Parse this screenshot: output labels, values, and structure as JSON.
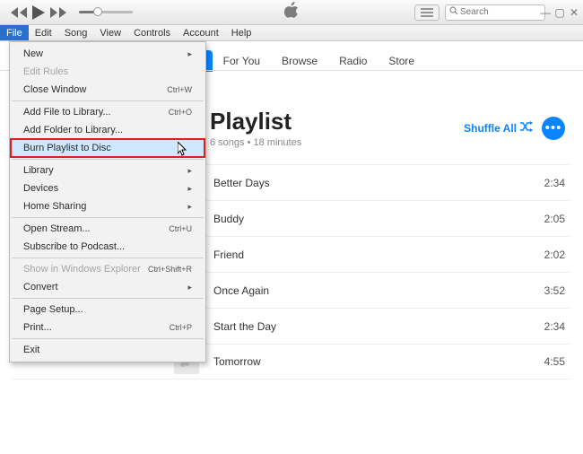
{
  "search": {
    "placeholder": "Search"
  },
  "menubar": [
    "File",
    "Edit",
    "Song",
    "View",
    "Controls",
    "Account",
    "Help"
  ],
  "file_menu": [
    {
      "label": "New",
      "shortcut": "",
      "sub": true
    },
    {
      "label": "Edit Rules",
      "shortcut": "",
      "disabled": true
    },
    {
      "label": "Close Window",
      "shortcut": "Ctrl+W"
    },
    {
      "sep": true
    },
    {
      "label": "Add File to Library...",
      "shortcut": "Ctrl+O"
    },
    {
      "label": "Add Folder to Library...",
      "shortcut": ""
    },
    {
      "label": "Burn Playlist to Disc",
      "shortcut": "",
      "highlight": true
    },
    {
      "sep": true
    },
    {
      "label": "Library",
      "shortcut": "",
      "sub": true
    },
    {
      "label": "Devices",
      "shortcut": "",
      "sub": true
    },
    {
      "label": "Home Sharing",
      "shortcut": "",
      "sub": true
    },
    {
      "sep": true
    },
    {
      "label": "Open Stream...",
      "shortcut": "Ctrl+U"
    },
    {
      "label": "Subscribe to Podcast...",
      "shortcut": ""
    },
    {
      "sep": true
    },
    {
      "label": "Show in Windows Explorer",
      "shortcut": "Ctrl+Shift+R",
      "disabled": true
    },
    {
      "label": "Convert",
      "shortcut": "",
      "sub": true
    },
    {
      "sep": true
    },
    {
      "label": "Page Setup...",
      "shortcut": ""
    },
    {
      "label": "Print...",
      "shortcut": "Ctrl+P"
    },
    {
      "sep": true
    },
    {
      "label": "Exit",
      "shortcut": ""
    }
  ],
  "tabs": [
    {
      "label": "ary",
      "active": true
    },
    {
      "label": "For You"
    },
    {
      "label": "Browse"
    },
    {
      "label": "Radio"
    },
    {
      "label": "Store"
    }
  ],
  "playlist": {
    "title": "Playlist",
    "subtitle": "6 songs • 18 minutes",
    "shuffle_label": "Shuffle All"
  },
  "songs": [
    {
      "title": "Better Days",
      "duration": "2:34"
    },
    {
      "title": "Buddy",
      "duration": "2:05"
    },
    {
      "title": "Friend",
      "duration": "2:02"
    },
    {
      "title": "Once Again",
      "duration": "3:52"
    },
    {
      "title": "Start the Day",
      "duration": "2:34"
    },
    {
      "title": "Tomorrow",
      "duration": "4:55"
    }
  ]
}
